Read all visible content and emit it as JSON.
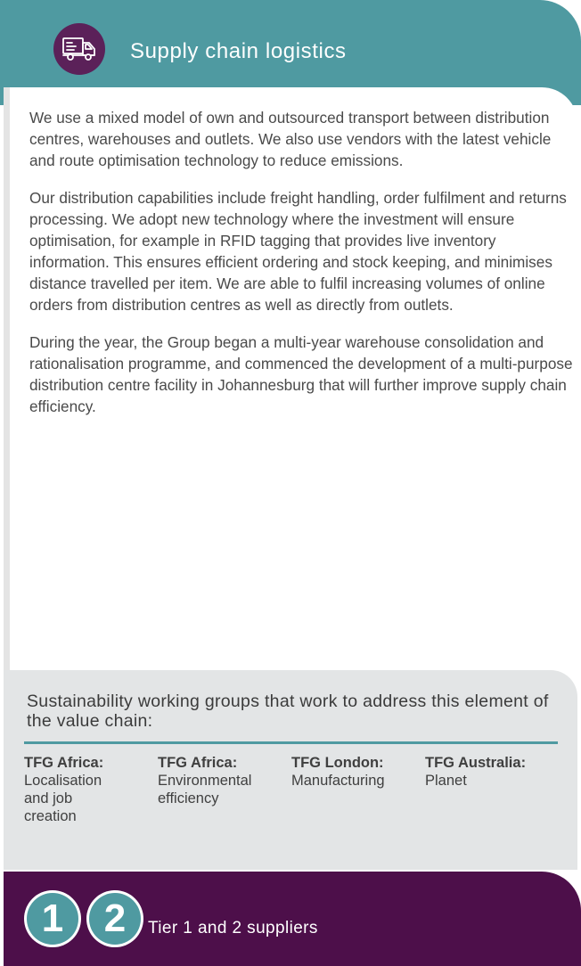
{
  "header": {
    "title": "Supply chain logistics",
    "icon": "delivery-truck-icon"
  },
  "body": {
    "paragraphs": [
      "We use a mixed model of own and outsourced transport between distribution centres, warehouses and outlets. We also use vendors with the latest vehicle and route optimisation technology to reduce emissions.",
      "Our distribution capabilities include freight handling, order fulfilment and returns processing. We adopt new technology where the investment will ensure optimisation, for example in RFID tagging that provides live inventory information. This ensures efficient ordering and stock keeping, and minimises distance travelled per item. We are able to fulfil increasing volumes of online orders from distribution centres as well as directly from outlets.",
      "During the year, the Group began a multi-year warehouse consolidation and rationalisation programme, and commenced the development of a multi-purpose distribution centre facility in Johannesburg that will further improve supply chain efficiency."
    ]
  },
  "groups": {
    "title": "Sustainability working groups that work to address this element of the value chain:",
    "items": [
      {
        "heading": "TFG Africa:",
        "text": "Localisation and job creation"
      },
      {
        "heading": "TFG Africa:",
        "text": "Environmental efficiency"
      },
      {
        "heading": "TFG London:",
        "text": "Manufacturing"
      },
      {
        "heading": "TFG Australia:",
        "text": "Planet"
      }
    ]
  },
  "tier": {
    "badge_1": "1",
    "badge_2": "2",
    "label": "Tier 1 and 2 suppliers"
  },
  "colors": {
    "teal": "#4f9aa1",
    "purple": "#4d0f4a",
    "icon_bg": "#5b2159",
    "panel_grey": "#e3e5e6"
  }
}
